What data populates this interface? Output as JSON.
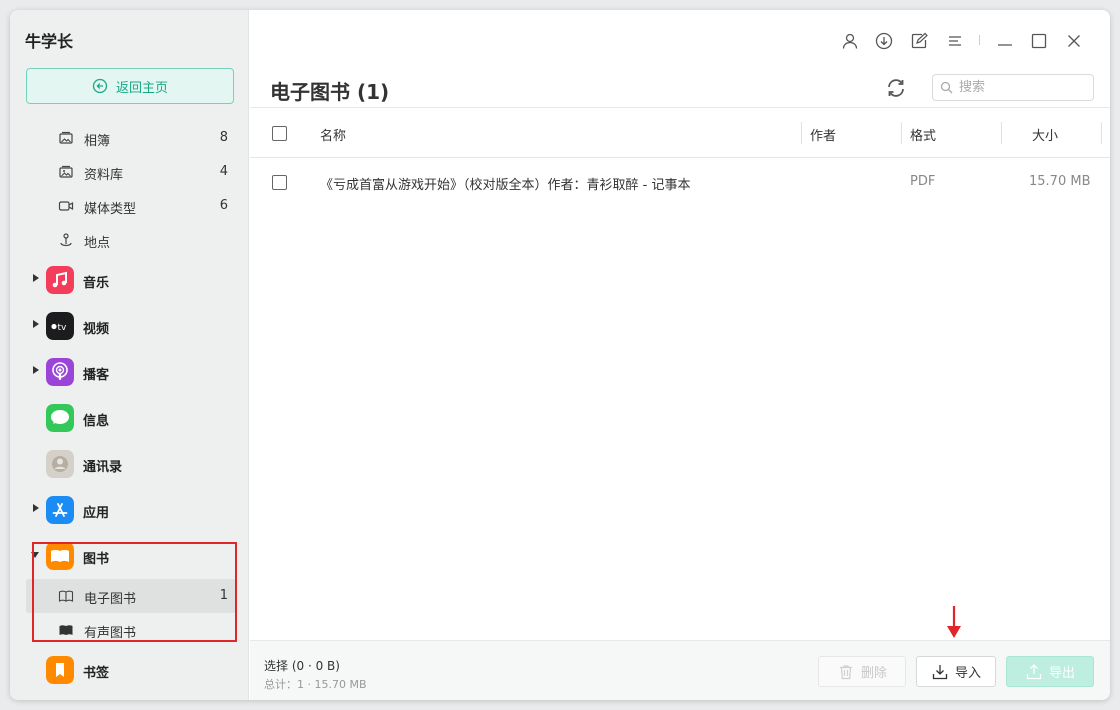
{
  "app": {
    "title": "牛学长"
  },
  "sidebar": {
    "home_button": "返回主页",
    "sub_items_top": [
      {
        "label": "相簿",
        "count": "8",
        "icon": "photo-album-icon"
      },
      {
        "label": "资料库",
        "count": "4",
        "icon": "library-icon"
      },
      {
        "label": "媒体类型",
        "count": "6",
        "icon": "video-camera-icon"
      },
      {
        "label": "地点",
        "count": "",
        "icon": "location-pin-icon"
      }
    ],
    "categories": [
      {
        "label": "音乐",
        "icon": "music-app-icon",
        "color": "#f33d5a"
      },
      {
        "label": "视频",
        "icon": "apple-tv-app-icon",
        "color": "#1c1c1e"
      },
      {
        "label": "播客",
        "icon": "podcasts-app-icon",
        "color": "#9b44d8"
      },
      {
        "label": "信息",
        "icon": "messages-app-icon",
        "color": "#34c759"
      },
      {
        "label": "通讯录",
        "icon": "contacts-app-icon",
        "color": "#c9c4bb"
      },
      {
        "label": "应用",
        "icon": "app-store-app-icon",
        "color": "#1a8cf3"
      },
      {
        "label": "图书",
        "icon": "books-app-icon",
        "color": "#ff8a00"
      },
      {
        "label": "书签",
        "icon": "bookmarks-app-icon",
        "color": "#ff8a00"
      }
    ],
    "book_sub_items": [
      {
        "label": "电子图书",
        "count": "1",
        "icon": "open-book-icon"
      },
      {
        "label": "有声图书",
        "count": "",
        "icon": "audiobook-icon"
      }
    ]
  },
  "main": {
    "title": "电子图书 (1)",
    "search_placeholder": "搜索",
    "columns": {
      "name": "名称",
      "author": "作者",
      "format": "格式",
      "size": "大小"
    },
    "rows": [
      {
        "name": "《亏成首富从游戏开始》（校对版全本）作者：青衫取醉 - 记事本",
        "author": "",
        "format": "PDF",
        "size": "15.70 MB"
      }
    ]
  },
  "footer": {
    "selection": "选择 (0 · 0 B)",
    "total": "总计：1 · 15.70 MB",
    "delete_label": "删除",
    "import_label": "导入",
    "export_label": "导出"
  },
  "colors": {
    "accent": "#19a886",
    "highlight": "#e0262a"
  }
}
